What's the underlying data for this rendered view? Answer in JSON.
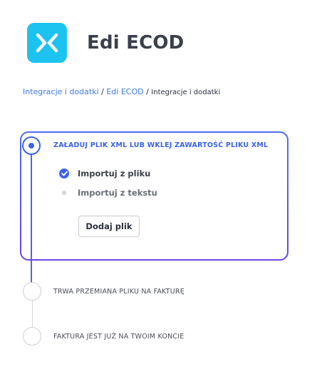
{
  "app": {
    "title": "Edi ECOD",
    "logo_icon": "ecod-logo-icon",
    "logo_color": "#1cc3f0"
  },
  "breadcrumb": {
    "items": [
      "Integracje i dodatki",
      "Edi ECOD"
    ],
    "separator": " / ",
    "current": "Integracje i dodatki"
  },
  "steps": [
    {
      "title": "ZAŁADUJ PLIK XML LUB WKLEJ ZAWARTOŚĆ PLIKU XML",
      "state": "active",
      "options": [
        {
          "label": "Importuj z pliku",
          "selected": true,
          "icon": "check-circle-icon"
        },
        {
          "label": "Importuj z tekstu",
          "selected": false,
          "icon": "radio-dot-icon"
        }
      ],
      "button_label": "Dodaj plik"
    },
    {
      "title": "TRWA PRZEMIANA PLIKU NA FAKTURĘ",
      "state": "pending"
    },
    {
      "title": "FAKTURA JEST JUŻ NA TWOIM KONCIE",
      "state": "pending"
    }
  ],
  "colors": {
    "accent": "#3b64e8",
    "accent_gradient_end": "#6a45e8",
    "muted": "#cdd0d6"
  }
}
